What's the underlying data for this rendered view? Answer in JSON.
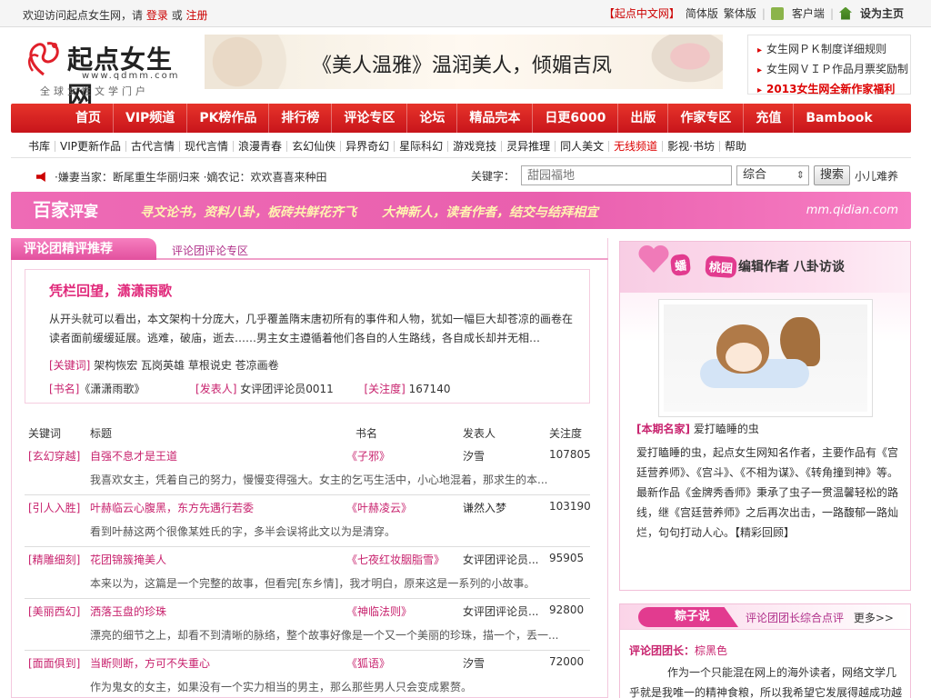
{
  "topbar": {
    "welcome": "欢迎访问起点女生网，请",
    "login": "登录",
    "or": "或",
    "register": "注册",
    "qidian_cn": "【起点中文网】",
    "simplified": "简体版",
    "traditional": "繁体版",
    "client": "客户端",
    "set_home": "设为主页"
  },
  "logo": {
    "name": "起点女生网",
    "url": "www.qdmm.com",
    "slogan": "全球女性文学门户"
  },
  "banner": {
    "text": "《美人温雅》温润美人，倾媚吉凤"
  },
  "promo": [
    "女生网ＰＫ制度详细规则",
    "女生网ＶＩＰ作品月票奖励制",
    "2013女生网全新作家福利"
  ],
  "main_nav": [
    "首页",
    "VIP频道",
    "PK榜作品",
    "排行榜",
    "评论专区",
    "论坛",
    "精品完本",
    "日更6000",
    "出版",
    "作家专区",
    "充值",
    "Bambook"
  ],
  "sub_nav": [
    "书库",
    "VIP更新作品",
    "古代言情",
    "现代言情",
    "浪漫青春",
    "玄幻仙侠",
    "异界奇幻",
    "星际科幻",
    "游戏竞技",
    "灵异推理",
    "同人美文",
    "无线频道",
    "影视·书坊",
    "帮助"
  ],
  "notice": "·嫌妻当家：断尾重生华丽归来  ·嫡农记：欢欢喜喜来种田",
  "search": {
    "label": "关键字：",
    "placeholder": "甜园福地",
    "category": "综合",
    "button": "搜索",
    "extra": "小儿难养"
  },
  "pink_strip": {
    "tab_a": "百家",
    "tab_b": "评宴",
    "slogan": "寻文论书，资料八卦，板砖共鲜花齐飞　　大神新人，读者作者，结交与结拜相宜",
    "url": "mm.qidian.com"
  },
  "left": {
    "title": "评论团精评推荐",
    "subtitle": "评论团评论专区",
    "feature": {
      "title": "凭栏回望，潇潇雨歌",
      "desc": "从开头就可以看出，本文架构十分庞大，几乎覆盖隋末唐初所有的事件和人物，犹如一幅巨大却苍凉的画卷在读者面前缓缓延展。逃难，破庙，逝去……男主女主遵循着他们各自的人生路线，各自成长却并无相…",
      "kw_label": "[关键词]",
      "kw": "架构恢宏 瓦岗英雄 草根说史 苍凉画卷",
      "book_label": "[书名]",
      "book": "《潇潇雨歌》",
      "pub_label": "[发表人]",
      "pub": "女评团评论员0011",
      "fol_label": "[关注度]",
      "fol": "167140"
    },
    "table": {
      "headers": [
        "关键词",
        "标题",
        "书名",
        "发表人",
        "关注度"
      ],
      "rows": [
        {
          "kw": "[玄幻穿越]",
          "title": "自强不息才是王道",
          "book": "《子邪》",
          "pub": "汐雪",
          "fol": "107805",
          "summary": "我喜欢女主，凭着自己的努力，慢慢变得强大。女主的乞丐生活中，小心地混着，那求生的本..."
        },
        {
          "kw": "[引人入胜]",
          "title": "叶赫临云心腹黑，东方先遇行若委",
          "book": "《叶赫凌云》",
          "pub": "谦然入梦",
          "fol": "103190",
          "summary": "看到叶赫这两个很像某姓氏的字，多半会误将此文以为是清穿。"
        },
        {
          "kw": "[精雕细刻]",
          "title": "花团锦簇掩美人",
          "book": "《七夜红妆胭脂雪》",
          "pub": "女评团评论员...",
          "fol": "95905",
          "summary": "本来以为，这篇是一个完整的故事，但看完[东乡情]，我才明白，原来这是一系列的小故事。"
        },
        {
          "kw": "[美丽西幻]",
          "title": "洒落玉盘的珍珠",
          "book": "《神临法则》",
          "pub": "女评团评论员...",
          "fol": "92800",
          "summary": "漂亮的细节之上，却看不到清晰的脉络，整个故事好像是一个又一个美丽的珍珠，描一个，丢一..."
        },
        {
          "kw": "[面面俱到]",
          "title": "当断则断，方可不失重心",
          "book": "《狐语》",
          "pub": "汐雪",
          "fol": "72000",
          "summary": "作为鬼女的女主，如果没有一个实力相当的男主，那么那些男人只会变成累赘。"
        }
      ]
    }
  },
  "right1": {
    "badge_a": "蟠",
    "badge_b": "桃园",
    "header": "编辑作者 八卦访谈",
    "famous_label": "[本期名家]",
    "famous": "爱打瞌睡的虫",
    "desc": "爱打瞌睡的虫，起点女生网知名作者，主要作品有《宫廷营养师》、《宫斗》、《不相为谋》、《转角撞到神》等。最新作品《金牌秀香师》秉承了虫子一贯温馨轻松的路线，继《宫廷营养师》之后再次出击，一路馥郁一路灿烂，句句打动人心。【精彩回顾】"
  },
  "right2": {
    "pill": "粽子说",
    "subtitle": "评论团团长综合点评",
    "more": "更多>>",
    "lead_label": "评论团团长：",
    "lead_name": "棕黑色",
    "text": "作为一个只能混在网上的海外读者，网络文学几乎就是我唯一的精神食粮，所以我希望它发展得越成功越好，"
  },
  "colors": {
    "nav_red": "#d42424",
    "pink": "#e95fae",
    "accent_text": "#c8236e"
  }
}
